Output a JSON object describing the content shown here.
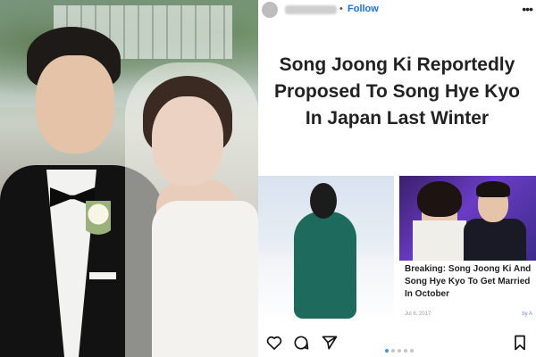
{
  "post": {
    "follow_label": "Follow",
    "dot_separator": "•",
    "headline": "Song Joong Ki Reportedly Proposed To Song Hye Kyo In Japan Last Winter",
    "related_card": {
      "title": "Breaking: Song Joong Ki And Song Hye Kyo To Get Married In October",
      "date": "Jul 6, 2017",
      "author": "by A"
    },
    "carousel": {
      "total": 5,
      "active_index": 0
    }
  },
  "icons": {
    "more": "more-options-icon",
    "like": "heart-icon",
    "comment": "comment-icon",
    "share": "send-icon",
    "save": "bookmark-icon"
  },
  "colors": {
    "follow": "#1b6fd8",
    "carousel_active": "#3897f0",
    "card_author": "#6d8bd1"
  }
}
